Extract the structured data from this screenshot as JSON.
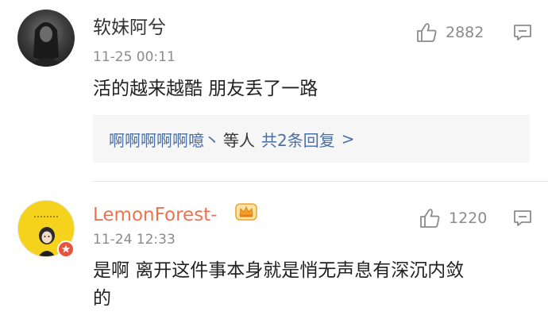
{
  "comments": [
    {
      "username": "软妹阿兮",
      "timestamp": "11-25 00:11",
      "like_count": "2882",
      "text": "活的越来越酷 朋友丢了一路",
      "replies": {
        "authors": "啊啊啊啊啊噫丶",
        "suffix": "等人",
        "total": "共2条回复",
        "chevron": ">"
      },
      "avatar_icon": "user-photo-avatar"
    },
    {
      "username": "LemonForest-",
      "timestamp": "11-24 12:33",
      "like_count": "1220",
      "text": "是啊 离开这件事本身就是悄无声息有深沉内敛的",
      "avatar_icon": "cartoon-girl-avatar",
      "badges": [
        "vip-crown-icon",
        "verified-badge-icon"
      ]
    }
  ],
  "colors": {
    "username_vip": "#eb7350",
    "link_blue": "#4a6fa5",
    "meta_gray": "#8b8b8b",
    "reply_box_bg": "#f6f6f6"
  }
}
